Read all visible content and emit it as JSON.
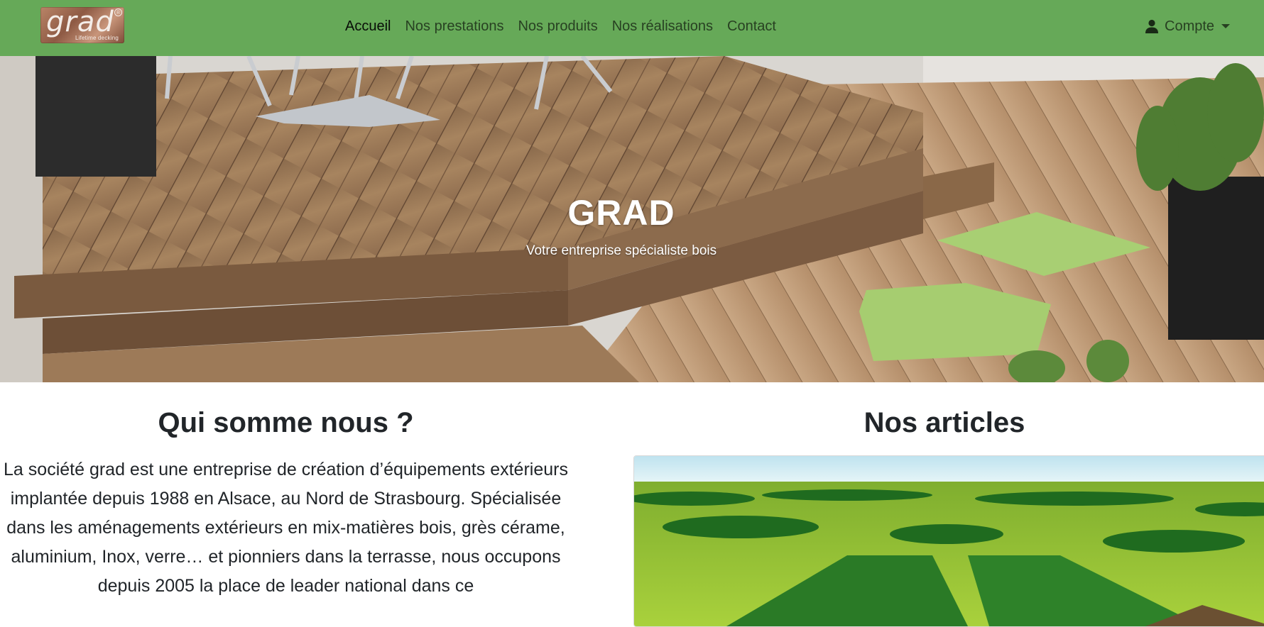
{
  "navbar": {
    "logo": {
      "word": "grad",
      "registered": "®",
      "tagline": "Lifetime decking"
    },
    "links": [
      {
        "label": "Accueil",
        "active": true
      },
      {
        "label": "Nos prestations",
        "active": false
      },
      {
        "label": "Nos produits",
        "active": false
      },
      {
        "label": "Nos réalisations",
        "active": false
      },
      {
        "label": "Contact",
        "active": false
      }
    ],
    "account": {
      "label": "Compte",
      "icon": "user-icon"
    },
    "background": "#66a958"
  },
  "hero": {
    "title": "GRAD",
    "subtitle": "Votre entreprise spécialiste bois"
  },
  "about": {
    "title": "Qui somme nous ?",
    "text": "La société grad est une entreprise de création d’équipements extérieurs implantée depuis 1988 en Alsace, au Nord de Strasbourg. Spécialisée dans les aménagements extérieurs en mix-matières bois, grès cérame, aluminium, Inox, verre… et pionniers dans la terrasse, nous occupons depuis 2005 la place de leader national dans ce"
  },
  "articles": {
    "title": "Nos articles"
  }
}
